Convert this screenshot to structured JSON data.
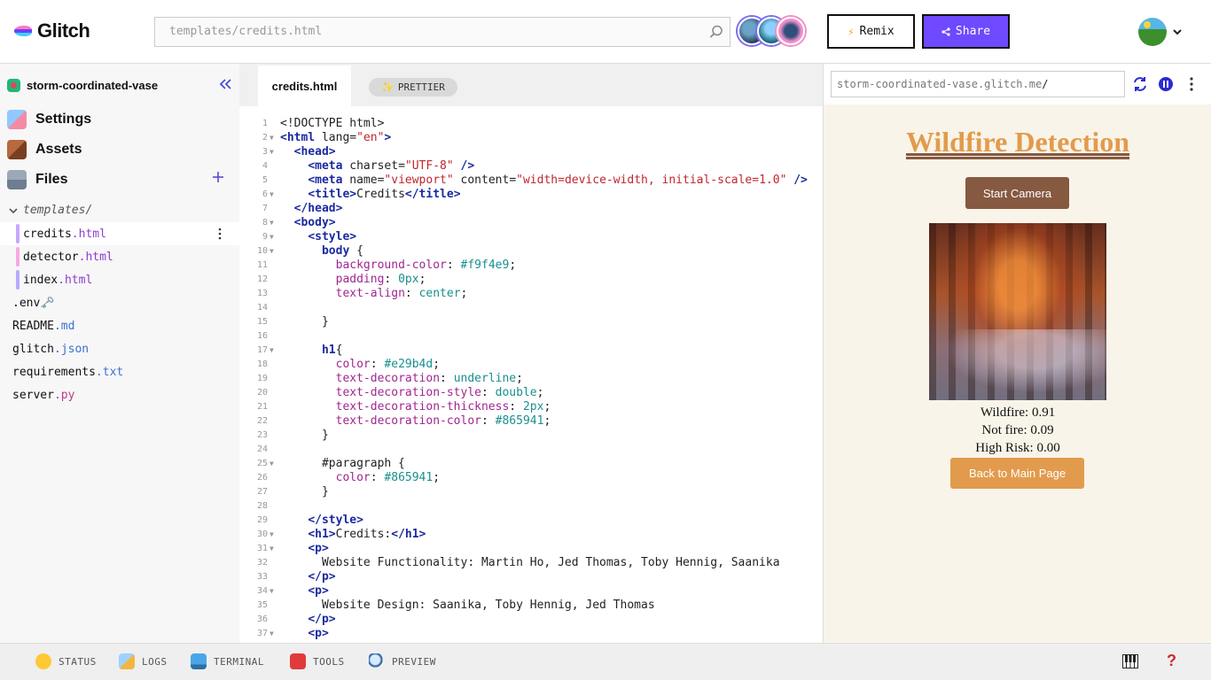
{
  "header": {
    "logo_text": "Glitch",
    "search_placeholder": "templates/credits.html",
    "remix_label": "Remix",
    "share_label": "Share"
  },
  "sidebar": {
    "project_name": "storm-coordinated-vase",
    "nav": [
      {
        "label": "Settings",
        "icon": "settings-icon"
      },
      {
        "label": "Assets",
        "icon": "assets-icon"
      },
      {
        "label": "Files",
        "icon": "files-icon"
      }
    ],
    "folder": "templates/",
    "template_files": [
      {
        "name": "credits",
        "ext": ".html",
        "color": "#c7a7ff"
      },
      {
        "name": "detector",
        "ext": ".html",
        "color": "#f6a9e3"
      },
      {
        "name": "index",
        "ext": ".html",
        "color": "#b7a9ff"
      }
    ],
    "root_files": [
      {
        "name": ".env",
        "ext": " 🗝️"
      },
      {
        "name": "README",
        "ext": ".md"
      },
      {
        "name": "glitch",
        "ext": ".json"
      },
      {
        "name": "requirements",
        "ext": ".txt"
      },
      {
        "name": "server",
        "ext": ".py"
      }
    ]
  },
  "editor": {
    "tab_label": "credits.html",
    "prettier_label": "PRETTIER"
  },
  "preview": {
    "url": "storm-coordinated-vase.glitch.me",
    "url_suffix": "/",
    "title": "Wildfire Detection",
    "camera_button": "Start Camera",
    "stats": [
      "Wildfire: 0.91",
      "Not fire: 0.09",
      "High Risk: 0.00"
    ],
    "back_button": "Back to Main Page"
  },
  "bottombar": {
    "items": [
      "STATUS",
      "LOGS",
      "TERMINAL",
      "TOOLS",
      "PREVIEW"
    ],
    "help": "?"
  },
  "colors": {
    "accent": "#6f49ff",
    "preview_bg": "#f9f4e9",
    "title_color": "#e29b4d",
    "brown": "#865941"
  }
}
